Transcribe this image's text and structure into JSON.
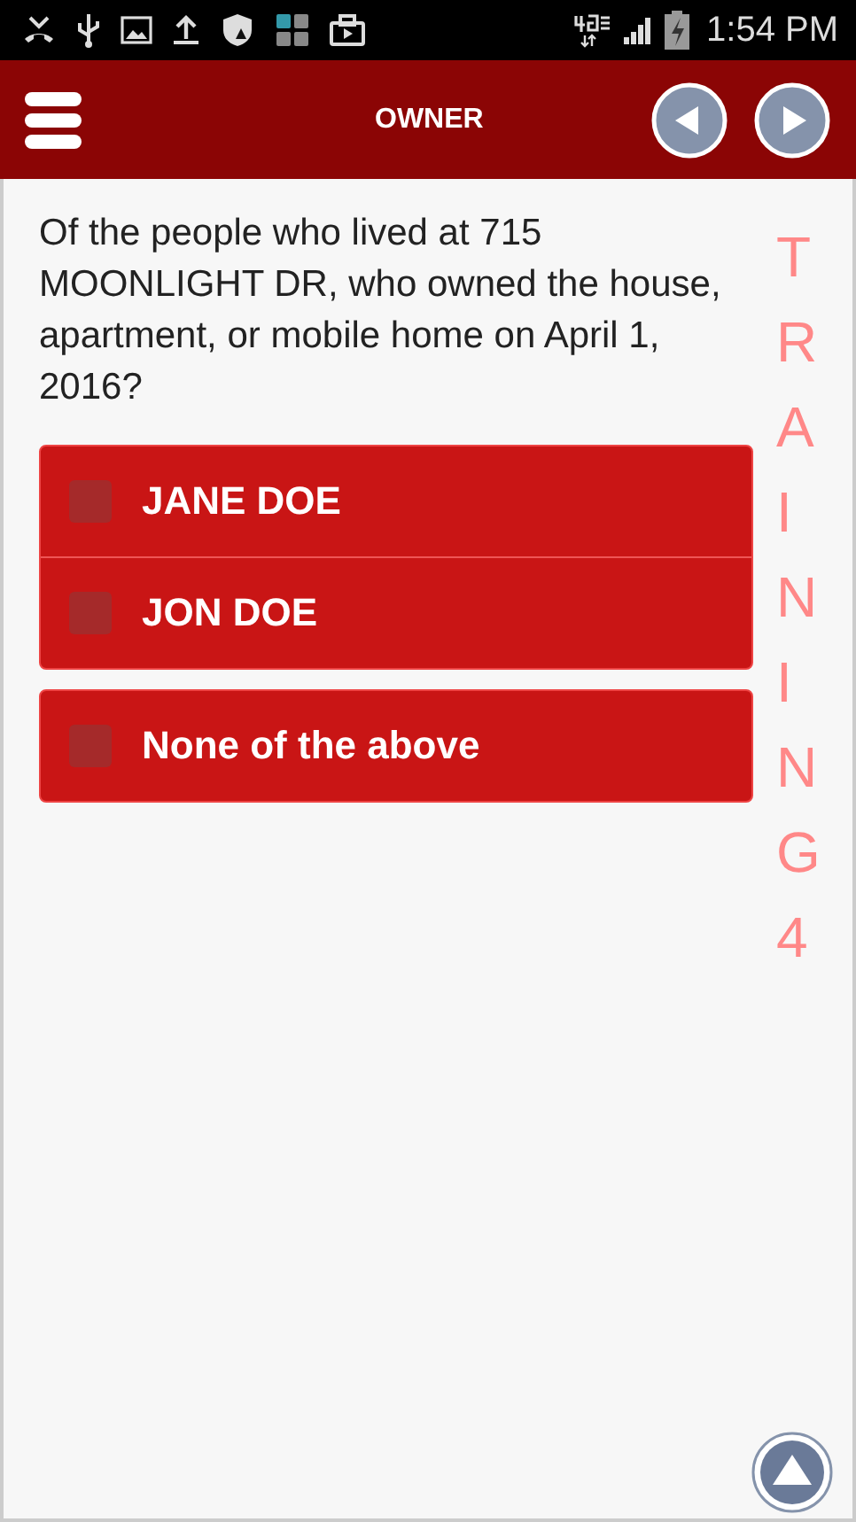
{
  "status_bar": {
    "time": "1:54 PM"
  },
  "header": {
    "title": "OWNER"
  },
  "question": "Of the people who lived at 715 MOONLIGHT DR, who owned the house, apartment, or mobile home on April 1, 2016?",
  "option_groups": [
    {
      "options": [
        {
          "label": "JANE DOE",
          "checked": false
        },
        {
          "label": "JON DOE",
          "checked": false
        }
      ]
    },
    {
      "options": [
        {
          "label": "None of the above",
          "checked": false
        }
      ]
    }
  ],
  "overlay_text": "TRAINING4"
}
